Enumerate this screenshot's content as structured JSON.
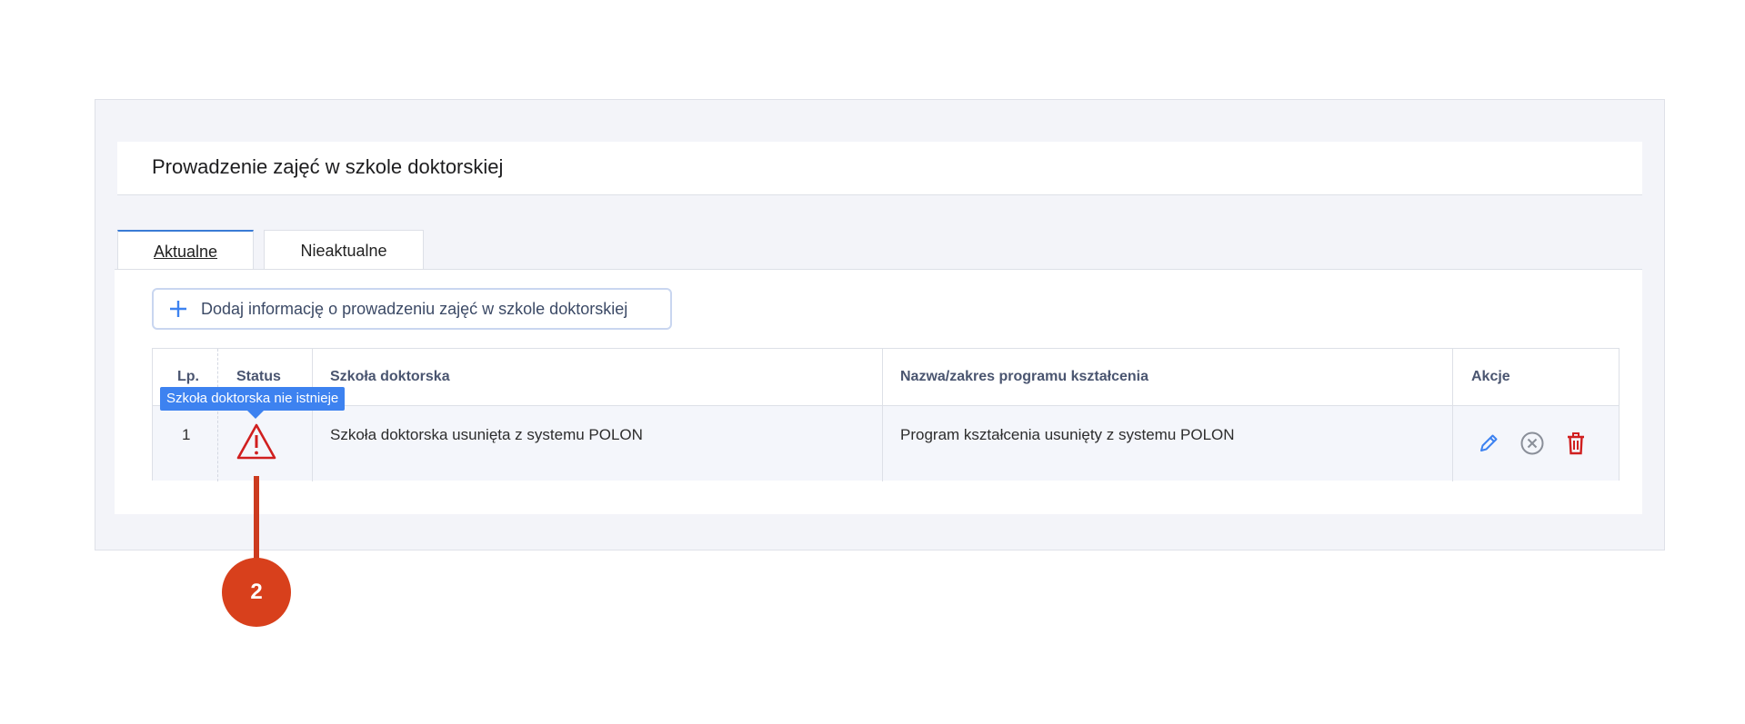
{
  "header": {
    "title": "Prowadzenie zajęć w szkole doktorskiej"
  },
  "tabs": [
    {
      "label": "Aktualne",
      "active": true
    },
    {
      "label": "Nieaktualne",
      "active": false
    }
  ],
  "add_button": {
    "label": "Dodaj informację o prowadzeniu zajęć w szkole doktorskiej",
    "icon": "plus-icon"
  },
  "table": {
    "columns": [
      "Lp.",
      "Status",
      "Szkoła doktorska",
      "Nazwa/zakres programu kształcenia",
      "Akcje"
    ],
    "rows": [
      {
        "lp": "1",
        "status_icon": "warning-icon",
        "szkola": "Szkoła doktorska usunięta z systemu POLON",
        "program": "Program kształcenia usunięty z systemu POLON",
        "actions": [
          "edit-icon",
          "cancel-icon",
          "delete-icon"
        ]
      }
    ]
  },
  "tooltip": {
    "text": "Szkoła doktorska nie istnieje"
  },
  "callout": {
    "number": "2"
  },
  "colors": {
    "accent": "#3d82f0",
    "warning": "#d01f1f",
    "delete": "#d01f1f",
    "callout": "#d8401c"
  }
}
